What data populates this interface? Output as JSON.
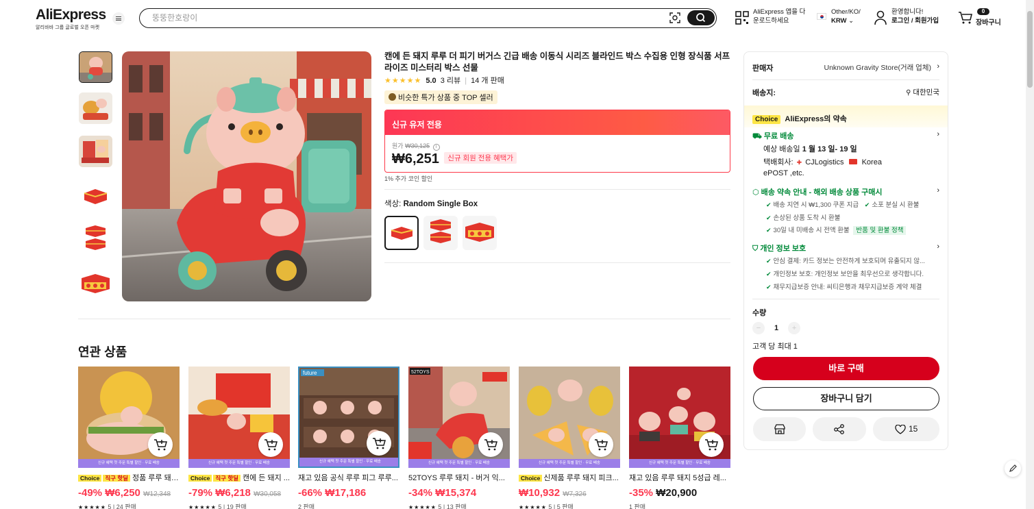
{
  "header": {
    "logo": "AliExpress",
    "logo_sub": "알리바바 그룹 글로벌 오픈 마켓",
    "search_placeholder": "뚱뚱한호랑이",
    "app_line1": "AliExpress 앱을 다",
    "app_line2": "운로드하세요",
    "region_line1": "Other/KO/",
    "region_line2": "KRW",
    "welcome": "환영합니다!",
    "login": "로그인 / 회원가입",
    "cart_count": "0",
    "cart_label": "장바구니"
  },
  "product": {
    "title": "캔에 든 돼지 루루 더 피기 버거스 긴급 배송 이동식 시리즈 블라인드 박스 수집용 인형 장식품 서프라이즈 미스터리 박스 선물",
    "stars": "★★★★★",
    "rating": "5.0",
    "reviews": "3 리뷰",
    "sold": "14 개 판매",
    "badge": "비슷한 특가 상품 중 TOP 셀러",
    "promo_header": "신규 유저 전용",
    "orig_label": "원가",
    "orig_price": "₩30,125",
    "price": "₩6,251",
    "new_user_tag": "신규 회원 전용 혜택가",
    "coins": "1% 추가 코인 할인",
    "color_label": "색상:",
    "color_value": "Random Single Box"
  },
  "panel": {
    "seller_label": "판매자",
    "seller_value": "Unknown Gravity Store(거래 업체)",
    "ship_to_label": "배송지:",
    "ship_to_value": "대한민국",
    "choice_tag": "Choice",
    "promise": "AliExpress의 약속",
    "free_ship": "무료 배송",
    "delivery_prefix": "예상 배송일",
    "delivery_dates": "1 월 13 일- 19 일",
    "carrier_label": "택배회사:",
    "carrier1": "CJLogistics",
    "carrier2": "Korea",
    "carrier3": "ePOST ,etc.",
    "guarantee_title": "배송 약속 안내 - 해외 배송 상품 구매시",
    "g1": "배송 지연 시 ₩1,300 쿠폰 지급",
    "g2": "소포 분실 시 환불",
    "g3": "손상된 상품 도착 시 환불",
    "g4": "30일 내 미배송 시 전액 환불",
    "g4_tag": "반품 및 환불 정책",
    "privacy_title": "개인 정보 보호",
    "p1": "안심 결제: 카드 정보는 안전하게 보호되며 유출되지 않...",
    "p2": "개인정보 보호: 개인정보 보안을 최우선으로 생각합니다.",
    "p3": "채무지급보증 안내: 씨티은행과 채무지급보증 계약 체결",
    "qty_label": "수량",
    "qty_value": "1",
    "max_per": "고객 당 최대 1",
    "buy_now": "바로 구매",
    "add_cart": "장바구니 담기",
    "likes": "15"
  },
  "related": {
    "title": "연관 상품",
    "band_text": "신규 혜택 첫 주문 특별 할인 · 무료 배송",
    "items": [
      {
        "choice": "Choice",
        "direct": "직구 핫딜",
        "name": "정품 루루 돼지...",
        "discount": "-49%",
        "price": "₩6,250",
        "old": "₩12,348",
        "meta": "5 | 24 판매"
      },
      {
        "choice": "Choice",
        "direct": "직구 핫딜",
        "name": "캔에 든 돼지 ...",
        "discount": "-79%",
        "price": "₩6,218",
        "old": "₩30,058",
        "meta": "5 | 19 판매"
      },
      {
        "choice": "",
        "direct": "",
        "name": "재고 있음 공식 루루 피그 루루...",
        "discount": "-66%",
        "price": "₩17,186",
        "old": "",
        "meta": "2 판매"
      },
      {
        "choice": "",
        "direct": "",
        "name": "52TOYS 루루 돼지 - 버거 익...",
        "discount": "-34%",
        "price": "₩15,374",
        "old": "",
        "meta": "5 | 13 판매"
      },
      {
        "choice": "Choice",
        "direct": "",
        "name": "신제품 루루 돼지 피크...",
        "discount": "",
        "price": "₩10,932",
        "old": "₩7,326",
        "meta": "5 | 5 판매"
      },
      {
        "choice": "",
        "direct": "",
        "name": "재고 있음 루루 돼지 5성급 레...",
        "discount": "-35%",
        "price": "₩20,900",
        "old": "",
        "meta": "1 판매"
      }
    ]
  },
  "colors": {
    "accent_red": "#d6001c",
    "promo_gradient": "#fd3755",
    "green": "#028a3a",
    "choice_yellow": "#fde545"
  }
}
